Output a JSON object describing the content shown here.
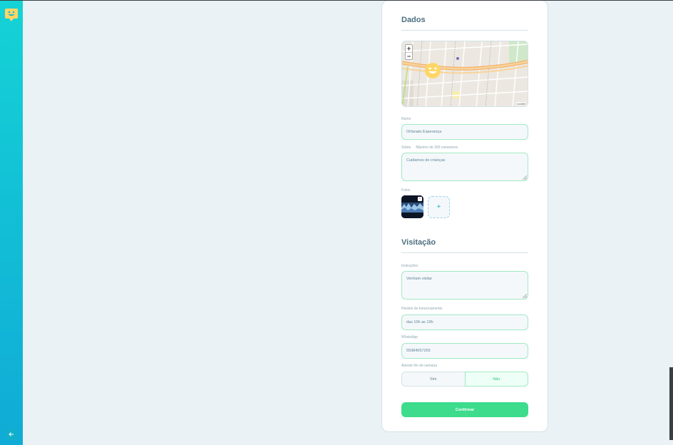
{
  "sidebar": {
    "logo_icon": "happy-face-logo",
    "back_icon": "arrow-left-icon"
  },
  "form": {
    "section_data": "Dados",
    "map": {
      "zoom_in": "+",
      "zoom_out": "−",
      "attribution": "Leaflet"
    },
    "name": {
      "label": "Nome",
      "value": "Orfanato Esperança"
    },
    "about": {
      "label": "Sobre",
      "hint": "Máximo de 300 caracteres",
      "value": "Cuidamos de crianças"
    },
    "photos": {
      "label": "Fotos",
      "remove_label": "×",
      "add_label": "+"
    },
    "section_visit": "Visitação",
    "instructions": {
      "label": "Instruções",
      "value": "Venham visitar"
    },
    "opening_hours": {
      "label": "Horário de funcionamento",
      "value": "das 10h as 19h"
    },
    "whatsapp": {
      "label": "WhatsApp",
      "value": "55984657265"
    },
    "weekends": {
      "label": "Atende fim de semana",
      "yes": "Sim",
      "no": "Não",
      "selected": "Não"
    },
    "confirm": "Confirmar"
  },
  "colors": {
    "accent": "#3cdc8c",
    "sidebar": "#15c3d6",
    "text": "#5c8599",
    "marker": "#ffd666"
  }
}
